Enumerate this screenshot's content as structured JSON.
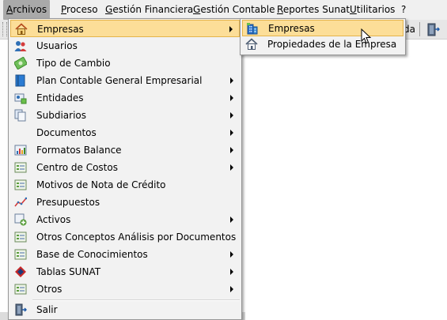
{
  "menubar": {
    "items": [
      {
        "label": "Archivos",
        "active": true
      },
      {
        "label": "Proceso"
      },
      {
        "label": "Gestión Financiera"
      },
      {
        "label": "Gestión Contable"
      },
      {
        "label": "Reportes Sunat"
      },
      {
        "label": "Utilitarios"
      },
      {
        "label": "?"
      }
    ]
  },
  "toolbar": {
    "partial_label": "da"
  },
  "archivos_menu": {
    "items": [
      {
        "label": "Empresas",
        "icon": "house-icon",
        "submenu": true,
        "highlighted": true
      },
      {
        "label": "Usuarios",
        "icon": "users-icon",
        "submenu": false
      },
      {
        "label": "Tipo de Cambio",
        "icon": "exchange-icon",
        "submenu": false
      },
      {
        "label": "Plan Contable General Empresarial",
        "icon": "book-icon",
        "submenu": true
      },
      {
        "label": "Entidades",
        "icon": "entities-icon",
        "submenu": true
      },
      {
        "label": "Subdiarios",
        "icon": "documents-icon",
        "submenu": true
      },
      {
        "label": "Documentos",
        "icon": "",
        "submenu": true
      },
      {
        "label": "Formatos Balance",
        "icon": "balance-chart-icon",
        "submenu": true
      },
      {
        "label": "Centro de Costos",
        "icon": "form-icon",
        "submenu": true
      },
      {
        "label": "Motivos de Nota de Crédito",
        "icon": "form-icon",
        "submenu": false
      },
      {
        "label": "Presupuestos",
        "icon": "trend-icon",
        "submenu": false
      },
      {
        "label": "Activos",
        "icon": "add-form-icon",
        "submenu": true
      },
      {
        "label": "Otros Conceptos Análisis por Documentos",
        "icon": "form-icon",
        "submenu": false
      },
      {
        "label": "Base de Conocimientos",
        "icon": "form-icon",
        "submenu": true
      },
      {
        "label": "Tablas SUNAT",
        "icon": "sunat-icon",
        "submenu": true
      },
      {
        "label": "Otros",
        "icon": "form-icon",
        "submenu": true
      },
      {
        "label": "Salir",
        "icon": "exit-door-icon",
        "submenu": false
      }
    ]
  },
  "empresas_submenu": {
    "items": [
      {
        "label": "Empresas",
        "icon": "building-icon",
        "highlighted": true
      },
      {
        "label": "Propiedades de la Empresa",
        "icon": "house-icon"
      }
    ]
  },
  "colors": {
    "highlight": "#fcde98",
    "highlight_border": "#e5b44a",
    "menubar_active": "#a9a9a9",
    "menu_bg": "#f2f2f2"
  }
}
